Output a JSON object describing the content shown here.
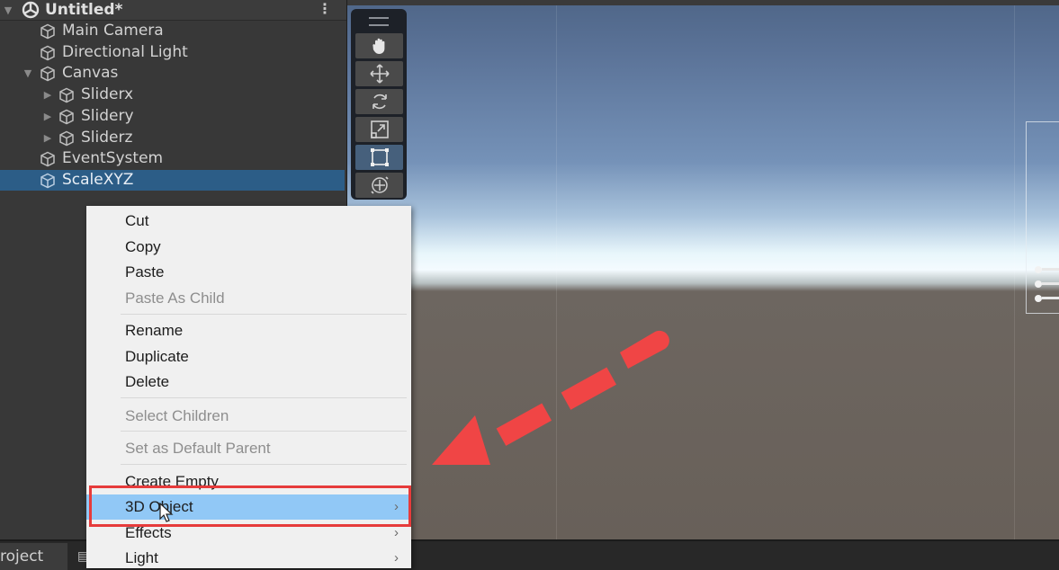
{
  "hierarchy": {
    "scene_title": "Untitled*",
    "items": [
      {
        "label": "Main Camera",
        "depth": 1,
        "foldout": "none"
      },
      {
        "label": "Directional Light",
        "depth": 1,
        "foldout": "none"
      },
      {
        "label": "Canvas",
        "depth": 1,
        "foldout": "expanded"
      },
      {
        "label": "Sliderx",
        "depth": 2,
        "foldout": "collapsed"
      },
      {
        "label": "Slidery",
        "depth": 2,
        "foldout": "collapsed"
      },
      {
        "label": "Sliderz",
        "depth": 2,
        "foldout": "collapsed"
      },
      {
        "label": "EventSystem",
        "depth": 1,
        "foldout": "none"
      },
      {
        "label": "ScaleXYZ",
        "depth": 1,
        "foldout": "none",
        "selected": true
      }
    ]
  },
  "scene_tools": [
    {
      "name": "hand-tool",
      "icon": "hand-icon",
      "active": false
    },
    {
      "name": "move-tool",
      "icon": "move-arrows-icon",
      "active": false
    },
    {
      "name": "rotate-tool",
      "icon": "rotate-icon",
      "active": false
    },
    {
      "name": "scale-tool",
      "icon": "scale-icon",
      "active": false
    },
    {
      "name": "rect-tool",
      "icon": "rect-transform-icon",
      "active": true
    },
    {
      "name": "transform-tool",
      "icon": "transform-icon",
      "active": false
    }
  ],
  "context_menu": {
    "items": [
      {
        "label": "Cut",
        "enabled": true
      },
      {
        "label": "Copy",
        "enabled": true
      },
      {
        "label": "Paste",
        "enabled": true
      },
      {
        "label": "Paste As Child",
        "enabled": false
      },
      {
        "label": "Rename",
        "enabled": true
      },
      {
        "label": "Duplicate",
        "enabled": true
      },
      {
        "label": "Delete",
        "enabled": true
      },
      {
        "label": "Select Children",
        "enabled": false
      },
      {
        "label": "Set as Default Parent",
        "enabled": false
      },
      {
        "label": "Create Empty",
        "enabled": true
      },
      {
        "label": "3D Object",
        "enabled": true,
        "submenu": true,
        "highlighted": true
      },
      {
        "label": "Effects",
        "enabled": true,
        "submenu": true
      },
      {
        "label": "Light",
        "enabled": true,
        "submenu": true
      }
    ],
    "submenu_arrow": "›"
  },
  "bottom_panel": {
    "project_tab": "roject"
  },
  "annotation": {
    "highlight_color": "#e63b3b",
    "arrow_color": "#f04545"
  }
}
